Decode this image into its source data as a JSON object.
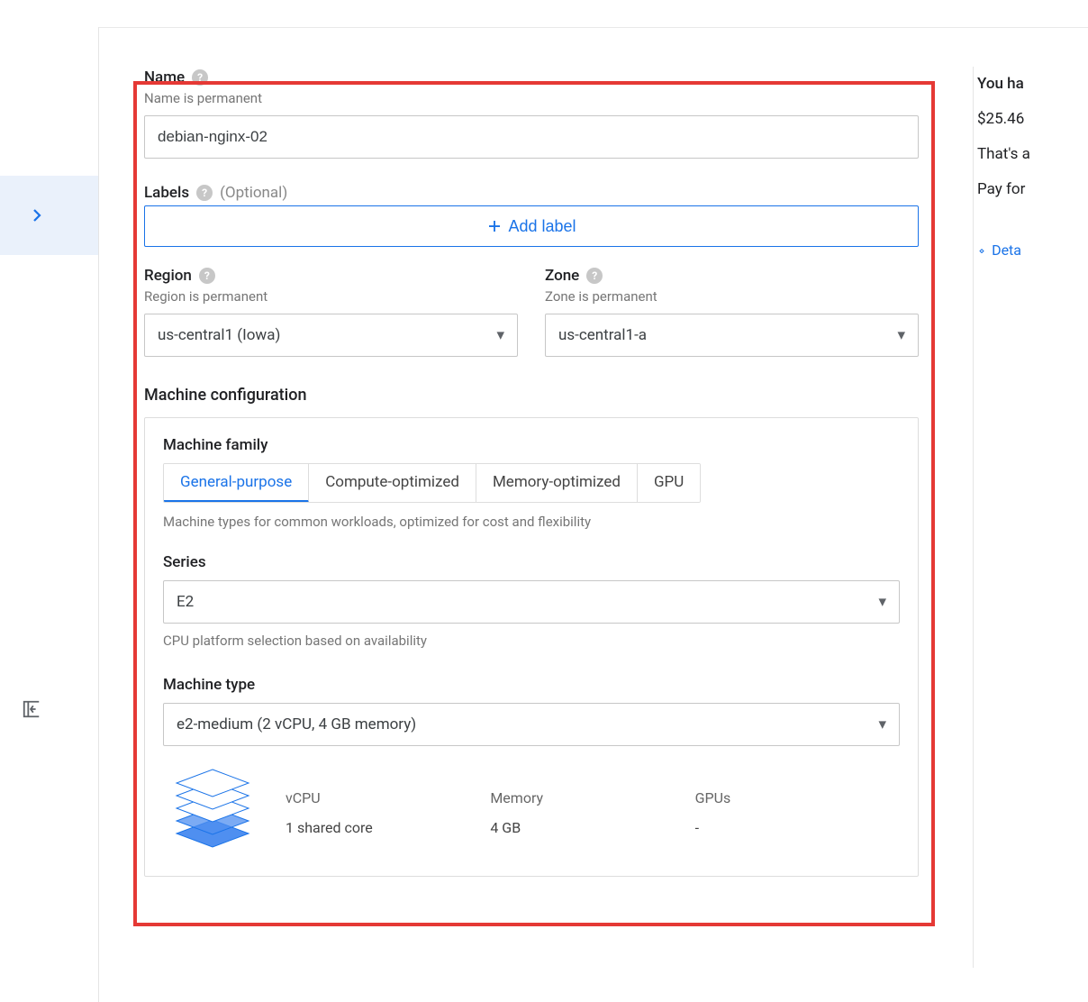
{
  "name": {
    "label": "Name",
    "subtext": "Name is permanent",
    "value": "debian-nginx-02"
  },
  "labels": {
    "label": "Labels",
    "optional": "(Optional)",
    "add_button": "Add label"
  },
  "region": {
    "label": "Region",
    "subtext": "Region is permanent",
    "value": "us-central1 (Iowa)"
  },
  "zone": {
    "label": "Zone",
    "subtext": "Zone is permanent",
    "value": "us-central1-a"
  },
  "machine": {
    "section_title": "Machine configuration",
    "family": {
      "label": "Machine family",
      "tabs": [
        {
          "label": "General-purpose",
          "active": true
        },
        {
          "label": "Compute-optimized",
          "active": false
        },
        {
          "label": "Memory-optimized",
          "active": false
        },
        {
          "label": "GPU",
          "active": false
        }
      ],
      "description": "Machine types for common workloads, optimized for cost and flexibility"
    },
    "series": {
      "label": "Series",
      "value": "E2",
      "subtext": "CPU platform selection based on availability"
    },
    "type": {
      "label": "Machine type",
      "value": "e2-medium (2 vCPU, 4 GB memory)"
    },
    "specs": {
      "vcpu_label": "vCPU",
      "vcpu_value": "1 shared core",
      "memory_label": "Memory",
      "memory_value": "4 GB",
      "gpu_label": "GPUs",
      "gpu_value": "-"
    }
  },
  "right": {
    "line1": "You ha",
    "line2": "$25.46",
    "line3": "That's a",
    "line4": "Pay for",
    "details": "Deta"
  }
}
